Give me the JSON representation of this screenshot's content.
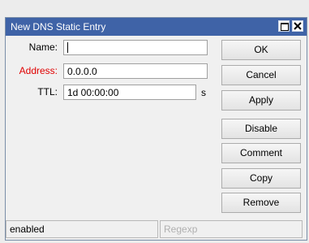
{
  "window": {
    "title": "New DNS Static Entry"
  },
  "form": {
    "name_label": "Name:",
    "name_value": "",
    "address_label": "Address:",
    "address_value": "0.0.0.0",
    "ttl_label": "TTL:",
    "ttl_value": "1d 00:00:00",
    "ttl_unit": "s"
  },
  "buttons": {
    "ok": "OK",
    "cancel": "Cancel",
    "apply": "Apply",
    "disable": "Disable",
    "comment": "Comment",
    "copy": "Copy",
    "remove": "Remove"
  },
  "status": {
    "state": "enabled",
    "mode": "Regexp"
  },
  "colors": {
    "titlebar": "#3f63a7",
    "invalid_label": "#e00000"
  },
  "icons": {
    "maximize": "maximize-icon",
    "close": "close-icon"
  }
}
